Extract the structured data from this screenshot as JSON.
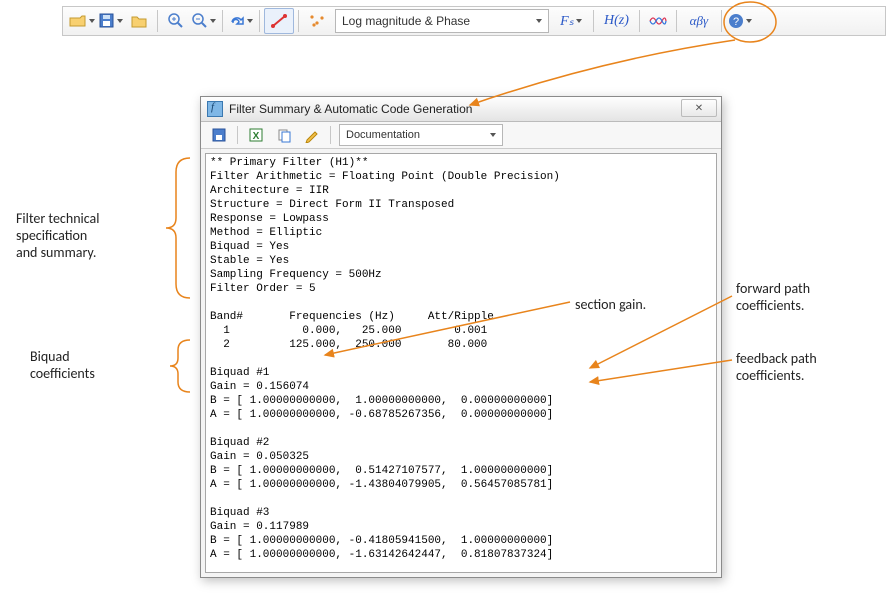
{
  "toolbar": {
    "view_label": "Log magnitude & Phase",
    "fs_label": "Fₛ",
    "hz_label": "H(z)",
    "abg_label": "αβγ"
  },
  "dialog": {
    "title": "Filter Summary & Automatic Code Generation",
    "close": "✕",
    "dropdown": "Documentation"
  },
  "filter_text": {
    "l00": "** Primary Filter (H1)**",
    "l01": "Filter Arithmetic = Floating Point (Double Precision)",
    "l02": "Architecture = IIR",
    "l03": "Structure = Direct Form II Transposed",
    "l04": "Response = Lowpass",
    "l05": "Method = Elliptic",
    "l06": "Biquad = Yes",
    "l07": "Stable = Yes",
    "l08": "Sampling Frequency = 500Hz",
    "l09": "Filter Order = 5",
    "l10": "",
    "l11": "Band#       Frequencies (Hz)     Att/Ripple",
    "l12": "  1           0.000,   25.000        0.001",
    "l13": "  2         125.000,  250.000       80.000",
    "l14": "",
    "l15": "Biquad #1",
    "l16": "Gain = 0.156074",
    "l17": "B = [ 1.00000000000,  1.00000000000,  0.00000000000]",
    "l18": "A = [ 1.00000000000, -0.68785267356,  0.00000000000]",
    "l19": "",
    "l20": "Biquad #2",
    "l21": "Gain = 0.050325",
    "l22": "B = [ 1.00000000000,  0.51427107577,  1.00000000000]",
    "l23": "A = [ 1.00000000000, -1.43804079905,  0.56457085781]",
    "l24": "",
    "l25": "Biquad #3",
    "l26": "Gain = 0.117989",
    "l27": "B = [ 1.00000000000, -0.41805941500,  1.00000000000]",
    "l28": "A = [ 1.00000000000, -1.63142642447,  0.81807837324]"
  },
  "annotations": {
    "spec": "Filter technical\nspecification\nand summary.",
    "biquad": "Biquad\ncoefficients",
    "gain": "section gain.",
    "fwd": "forward path\ncoefficients.",
    "fbk": "feedback path\ncoefficients."
  }
}
